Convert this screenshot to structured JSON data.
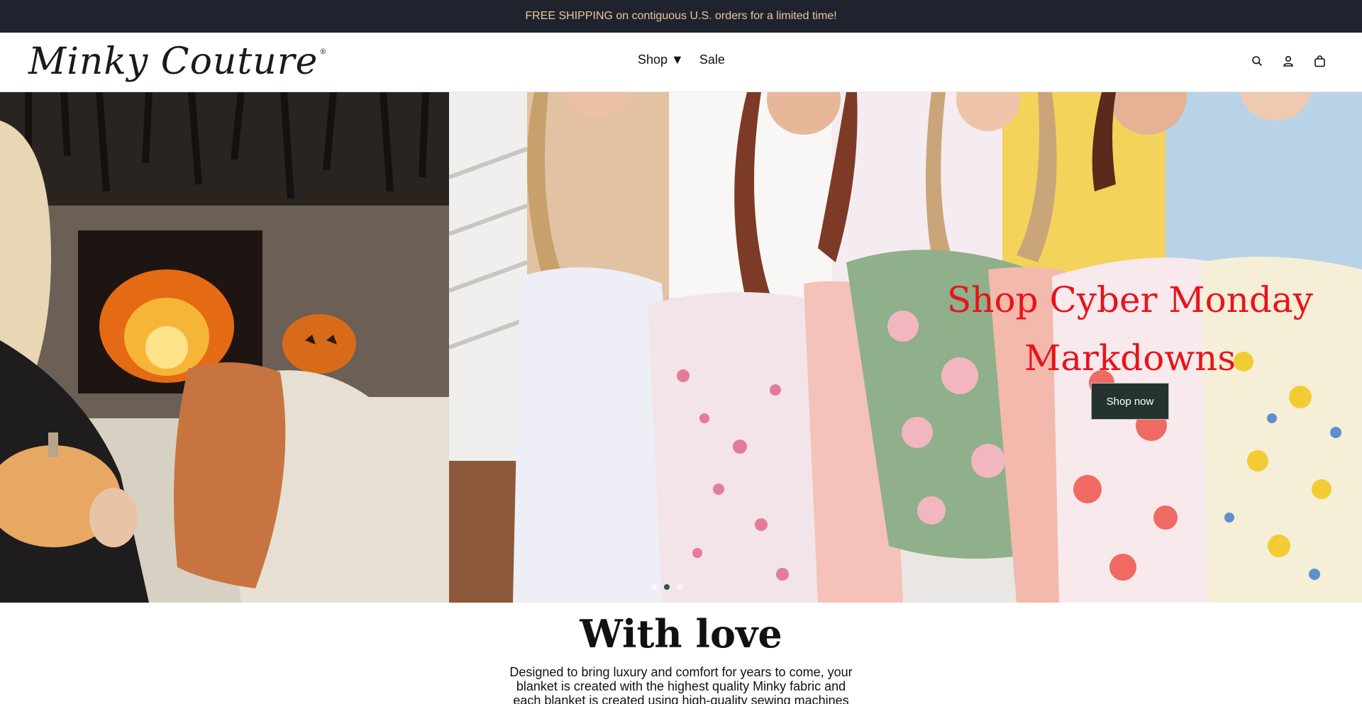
{
  "announcement": "FREE SHIPPING on contiguous U.S. orders for a limited time!",
  "brand": {
    "logo_text": "Minky Couture",
    "registered_mark": "®"
  },
  "nav": {
    "items": [
      {
        "label": "Shop ▼"
      },
      {
        "label": "Sale"
      }
    ]
  },
  "header_icons": [
    "search-icon",
    "account-icon",
    "cart-icon"
  ],
  "hero": {
    "headline": "Shop Cyber Monday Markdowns",
    "cta_label": "Shop now",
    "slides_count": 3,
    "active_slide": 2,
    "headline_color": "#e8131b",
    "cta_color": "#25332f"
  },
  "intro": {
    "title": "With love",
    "text": "Designed to bring luxury and comfort for years to come, your blanket is created with the highest quality Minky fabric and each blanket is created using high-quality sewing machines"
  },
  "colors": {
    "announcement_bg": "#1f232e",
    "announcement_text": "#e9c89a"
  }
}
